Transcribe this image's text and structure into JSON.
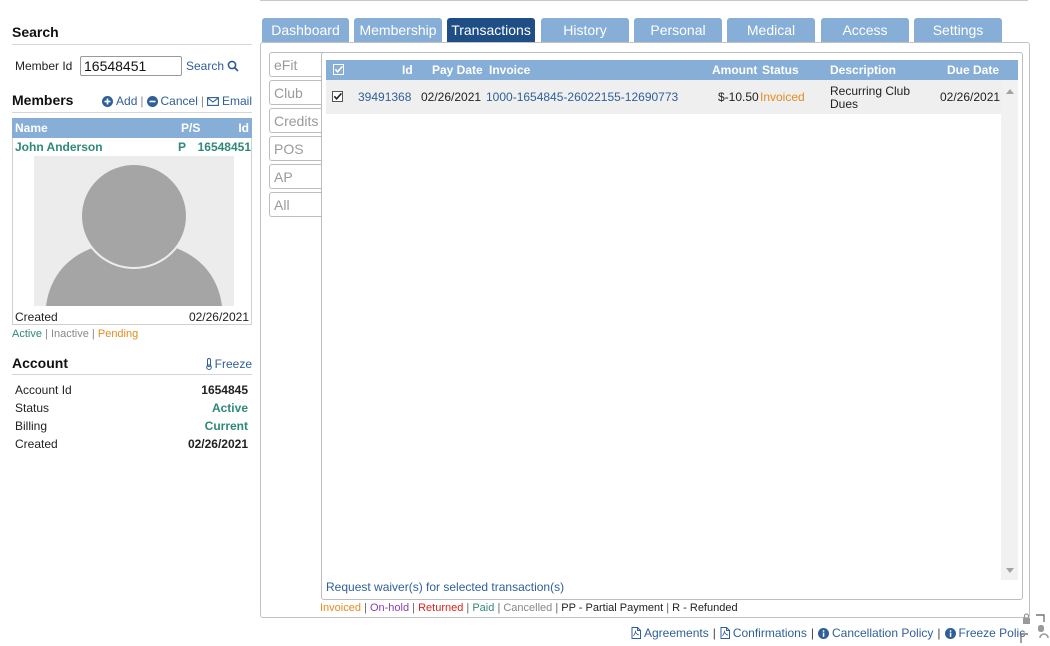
{
  "search": {
    "title": "Search",
    "member_id_label": "Member Id",
    "member_id_value": "16548451",
    "search_label": "Search"
  },
  "members": {
    "title": "Members",
    "add_label": "Add",
    "cancel_label": "Cancel",
    "email_label": "Email",
    "columns": {
      "name": "Name",
      "ps": "P/S",
      "id": "Id"
    },
    "row": {
      "name": "John Anderson",
      "ps": "P",
      "id": "16548451"
    },
    "created_label": "Created",
    "created_value": "02/26/2021",
    "status_legend": {
      "active": "Active",
      "inactive": "Inactive",
      "pending": "Pending"
    }
  },
  "account": {
    "title": "Account",
    "freeze_label": "Freeze",
    "rows": [
      {
        "label": "Account Id",
        "value": "1654845"
      },
      {
        "label": "Status",
        "value": "Active"
      },
      {
        "label": "Billing",
        "value": "Current"
      },
      {
        "label": "Created",
        "value": "02/26/2021"
      }
    ]
  },
  "tabs": [
    "Dashboard",
    "Membership",
    "Transactions",
    "History",
    "Personal",
    "Medical",
    "Access",
    "Settings"
  ],
  "active_tab": "Transactions",
  "subtabs": [
    "eFit",
    "Club",
    "Credits",
    "POS",
    "AP",
    "All"
  ],
  "transactions": {
    "columns": {
      "id": "Id",
      "pay_date": "Pay Date",
      "invoice": "Invoice",
      "amount": "Amount",
      "status": "Status",
      "description": "Description",
      "due_date": "Due Date"
    },
    "rows": [
      {
        "id": "39491368",
        "pay_date": "02/26/2021",
        "invoice": "1000-1654845-26022155-12690773",
        "amount": "$-10.50",
        "status": "Invoiced",
        "description": "Recurring Club Dues",
        "due_date": "02/26/2021"
      }
    ],
    "waiver_link": "Request waiver(s) for selected transaction(s)"
  },
  "status_legend": {
    "invoiced": "Invoiced",
    "onhold": "On-hold",
    "returned": "Returned",
    "paid": "Paid",
    "cancelled": "Cancelled",
    "pp": "PP - Partial Payment",
    "r": "R - Refunded"
  },
  "footer": {
    "agreements": "Agreements",
    "confirmations": "Confirmations",
    "cancellation_policy": "Cancellation Policy",
    "freeze_policy": "Freeze Polic"
  },
  "colors": {
    "header_blue": "#86aed6",
    "active_tab": "#1f4e86",
    "link": "#2f5f98",
    "green": "#2e8a78",
    "orange": "#e68a1f",
    "purple": "#8e3fb3",
    "red": "#e0201c"
  }
}
